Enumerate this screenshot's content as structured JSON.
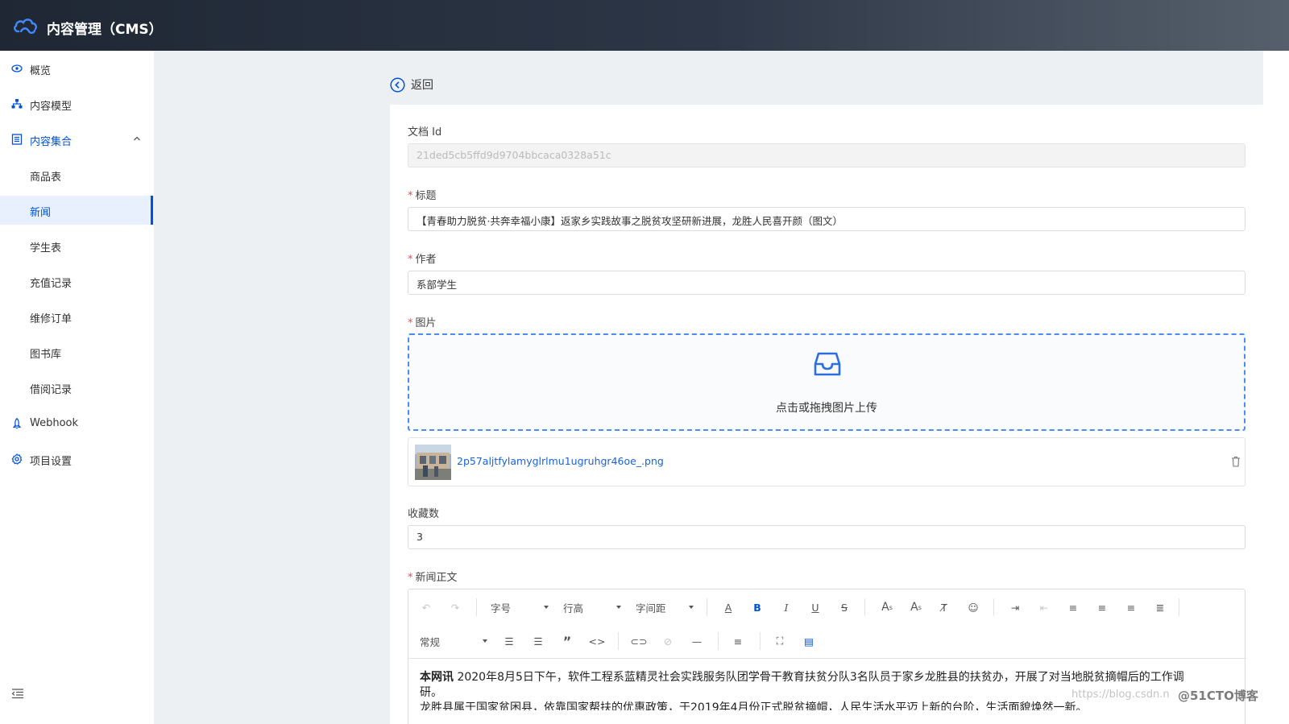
{
  "app": {
    "title": "内容管理（CMS）"
  },
  "sidebar": {
    "items": [
      {
        "label": "概览",
        "icon": "eye-icon"
      },
      {
        "label": "内容模型",
        "icon": "sitemap-icon"
      },
      {
        "label": "内容集合",
        "icon": "list-icon",
        "expanded": true
      },
      {
        "label": "商品表"
      },
      {
        "label": "新闻",
        "selected": true
      },
      {
        "label": "学生表"
      },
      {
        "label": "充值记录"
      },
      {
        "label": "维修订单"
      },
      {
        "label": "图书库"
      },
      {
        "label": "借阅记录"
      },
      {
        "label": "Webhook",
        "icon": "rocket-icon"
      },
      {
        "label": "项目设置",
        "icon": "gear-icon"
      }
    ]
  },
  "back": {
    "label": "返回"
  },
  "form": {
    "doc_id": {
      "label": "文档 Id",
      "value": "21ded5cb5ffd9d9704bbcaca0328a51c"
    },
    "title": {
      "label": "标题",
      "required": true,
      "value": "【青春助力脱贫·共奔幸福小康】返家乡实践故事之脱贫攻坚研新进展，龙胜人民喜开颜（图文）"
    },
    "author": {
      "label": "作者",
      "required": true,
      "value": "系部学生"
    },
    "image": {
      "label": "图片",
      "required": true,
      "upload_hint": "点击或拖拽图片上传",
      "file_name": "2p57aljtfylamyglrlmu1ugruhgr46oe_.png"
    },
    "favorites": {
      "label": "收藏数",
      "value": "3"
    },
    "body": {
      "label": "新闻正文",
      "required": true
    }
  },
  "editor": {
    "toolbar1": {
      "font_size": "字号",
      "line_height": "行高",
      "letter_spacing": "字间距"
    },
    "toolbar2": {
      "paragraph": "常规"
    },
    "content": {
      "lead": "本网讯",
      "line1": " 2020年8月5日下午，软件工程系蓝精灵社会实践服务队团学骨干教育扶贫分队3名队员于家乡龙胜县的扶贫办，开展了对当地脱贫摘帽后的工作调",
      "line1b": "研。",
      "line2": "龙胜县属于国家贫困县，依靠国家帮扶的优惠政策，于2019年4月份正式脱贫摘帽，人民生活水平迈上新的台阶，生活面貌焕然一新。"
    }
  },
  "watermark": {
    "site": "https://blog.csdn.n",
    "brand": "@51CTO博客"
  },
  "colors": {
    "primary": "#0052d9",
    "required": "#e34d59",
    "link": "#1a63d6"
  }
}
